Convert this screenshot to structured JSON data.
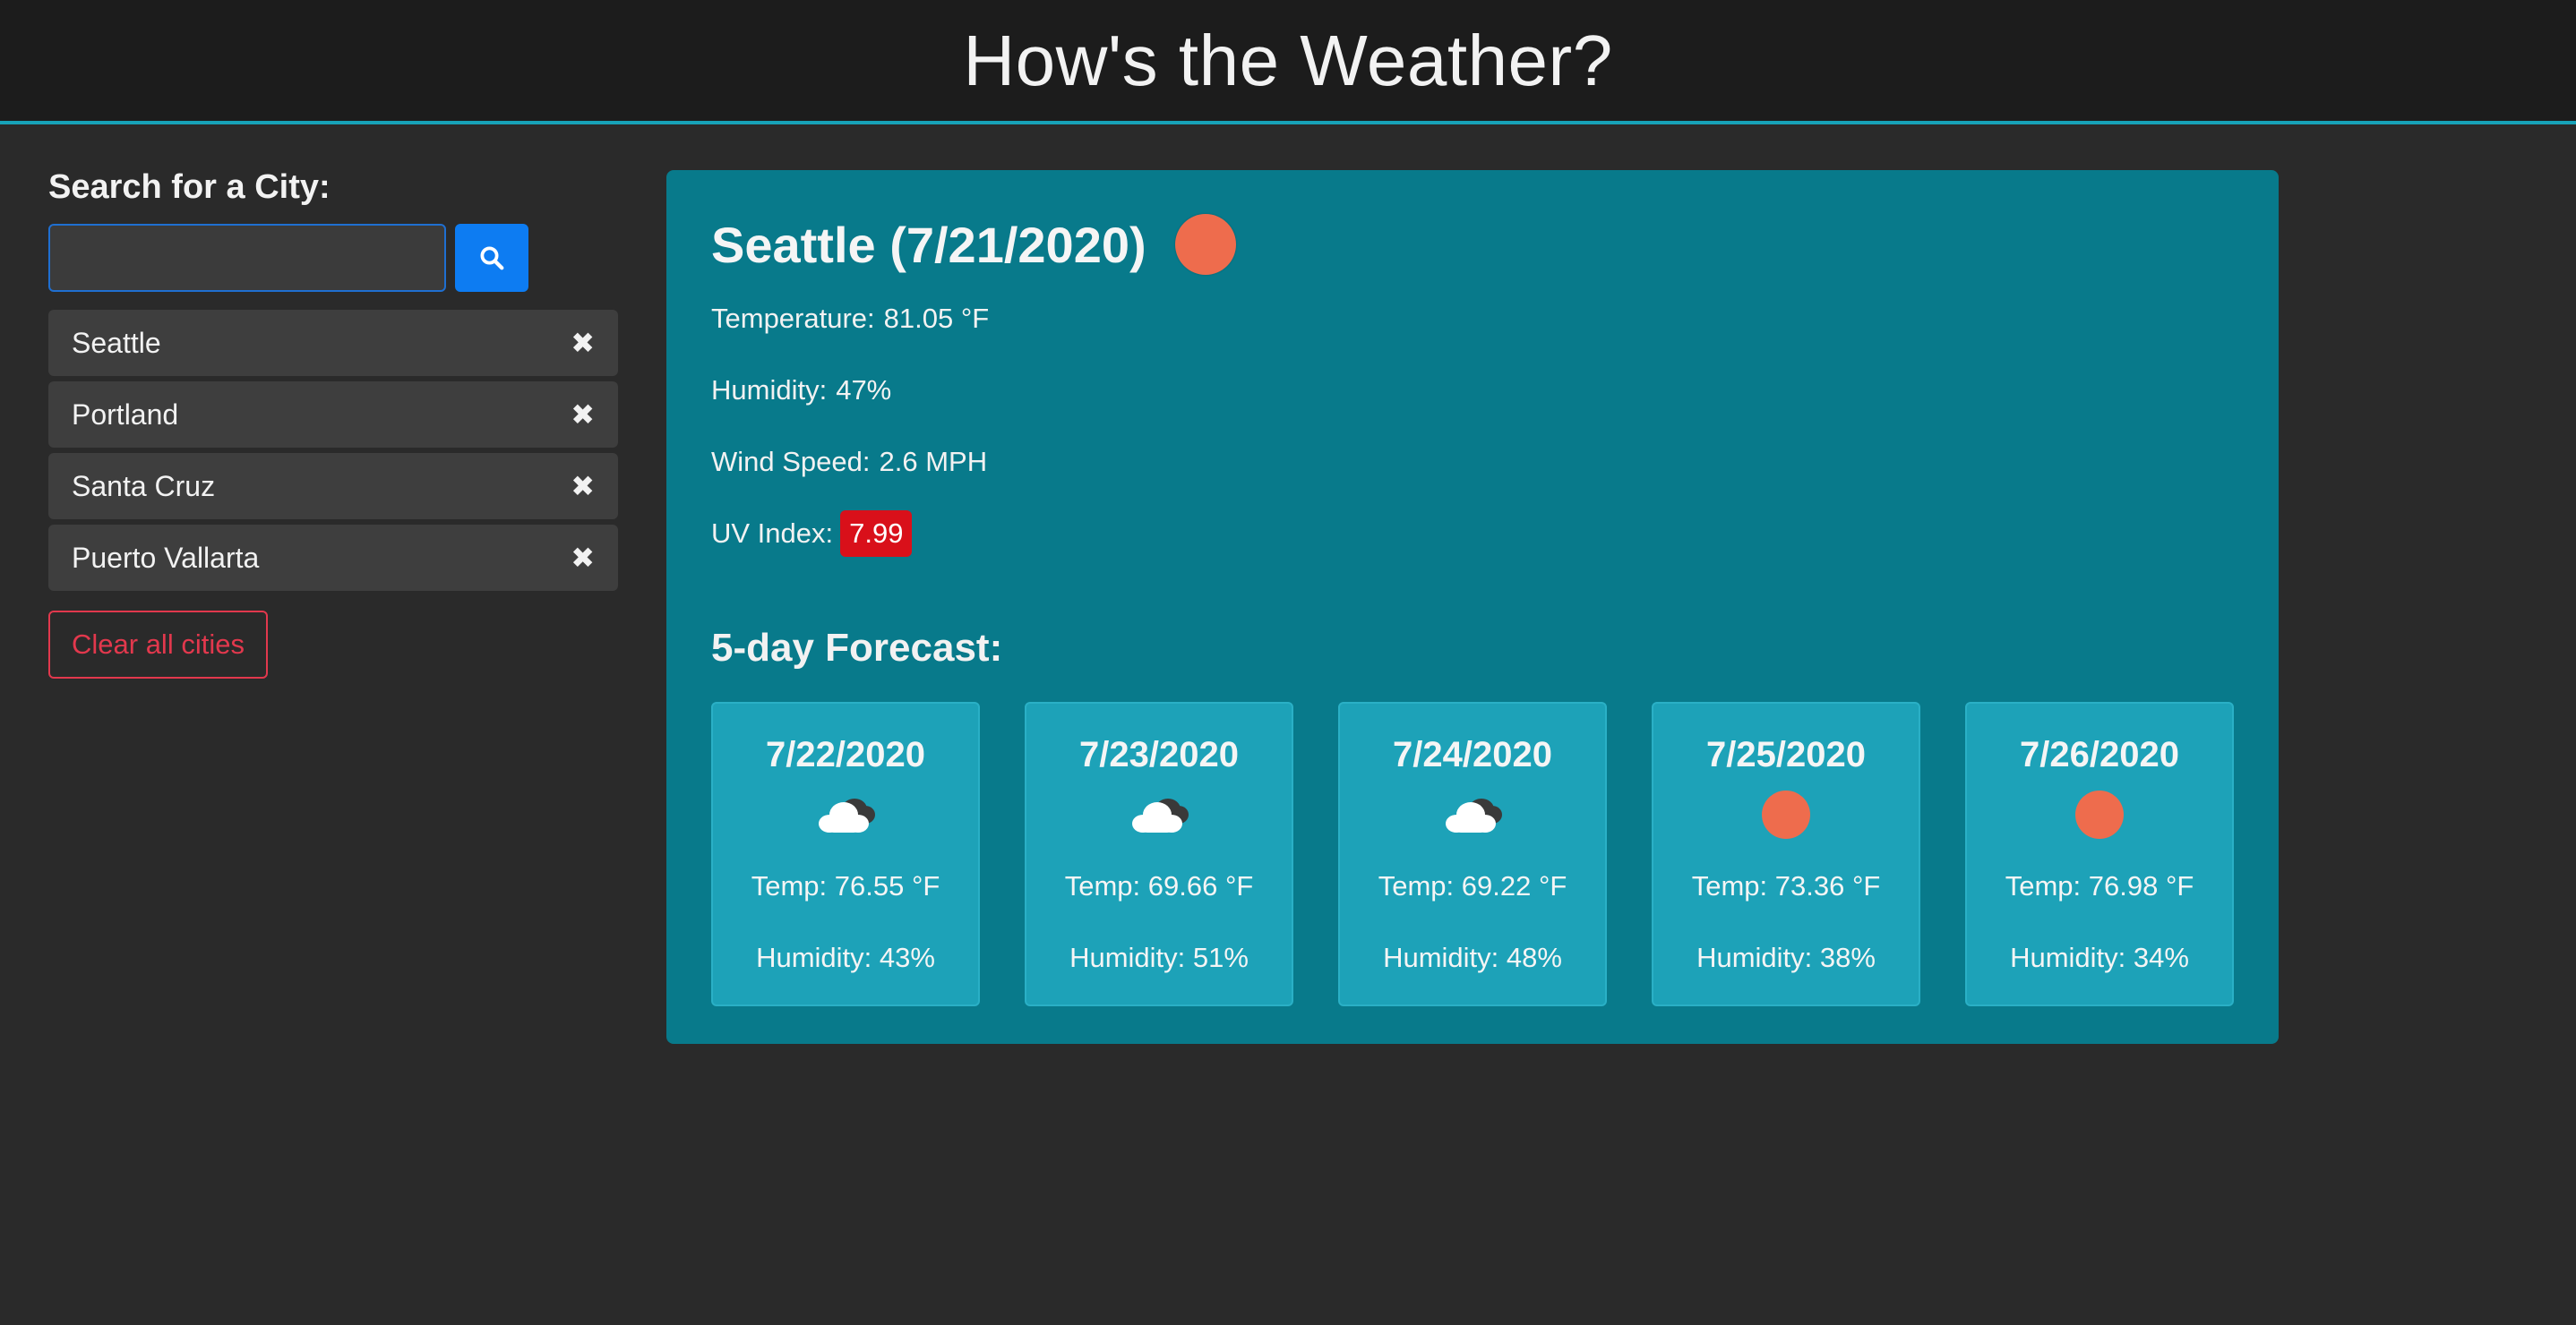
{
  "header": {
    "title": "How's the Weather?"
  },
  "sidebar": {
    "search_label": "Search for a City:",
    "search_placeholder": "",
    "search_value": "",
    "cities": [
      {
        "name": "Seattle",
        "remove_icon": "✖"
      },
      {
        "name": "Portland",
        "remove_icon": "✖"
      },
      {
        "name": "Santa Cruz",
        "remove_icon": "✖"
      },
      {
        "name": "Puerto Vallarta",
        "remove_icon": "✖"
      }
    ],
    "clear_label": "Clear all cities"
  },
  "current": {
    "title": "Seattle (7/21/2020)",
    "icon": "sun-icon",
    "temperature_label": "Temperature:",
    "temperature": "81.05 °F",
    "humidity_label": "Humidity:",
    "humidity": "47%",
    "wind_label": "Wind Speed:",
    "wind": "2.6 MPH",
    "uv_label": "UV Index:",
    "uv": "7.99",
    "uv_color": "#d9101a"
  },
  "forecast": {
    "title": "5-day Forecast:",
    "days": [
      {
        "date": "7/22/2020",
        "icon": "cloud-icon",
        "temp": "Temp: 76.55 °F",
        "humidity": "Humidity: 43%"
      },
      {
        "date": "7/23/2020",
        "icon": "cloud-icon",
        "temp": "Temp: 69.66 °F",
        "humidity": "Humidity: 51%"
      },
      {
        "date": "7/24/2020",
        "icon": "cloud-icon",
        "temp": "Temp: 69.22 °F",
        "humidity": "Humidity: 48%"
      },
      {
        "date": "7/25/2020",
        "icon": "sun-icon",
        "temp": "Temp: 73.36 °F",
        "humidity": "Humidity: 38%"
      },
      {
        "date": "7/26/2020",
        "icon": "sun-icon",
        "temp": "Temp: 76.98 °F",
        "humidity": "Humidity: 34%"
      }
    ]
  },
  "colors": {
    "header_bg": "#1c1c1c",
    "accent": "#17a2b8",
    "panel_bg": "#087a8b",
    "card_bg": "#1da2b8",
    "search_button": "#0d7cf2",
    "danger": "#e2384d",
    "sun": "#ee6c4d"
  }
}
